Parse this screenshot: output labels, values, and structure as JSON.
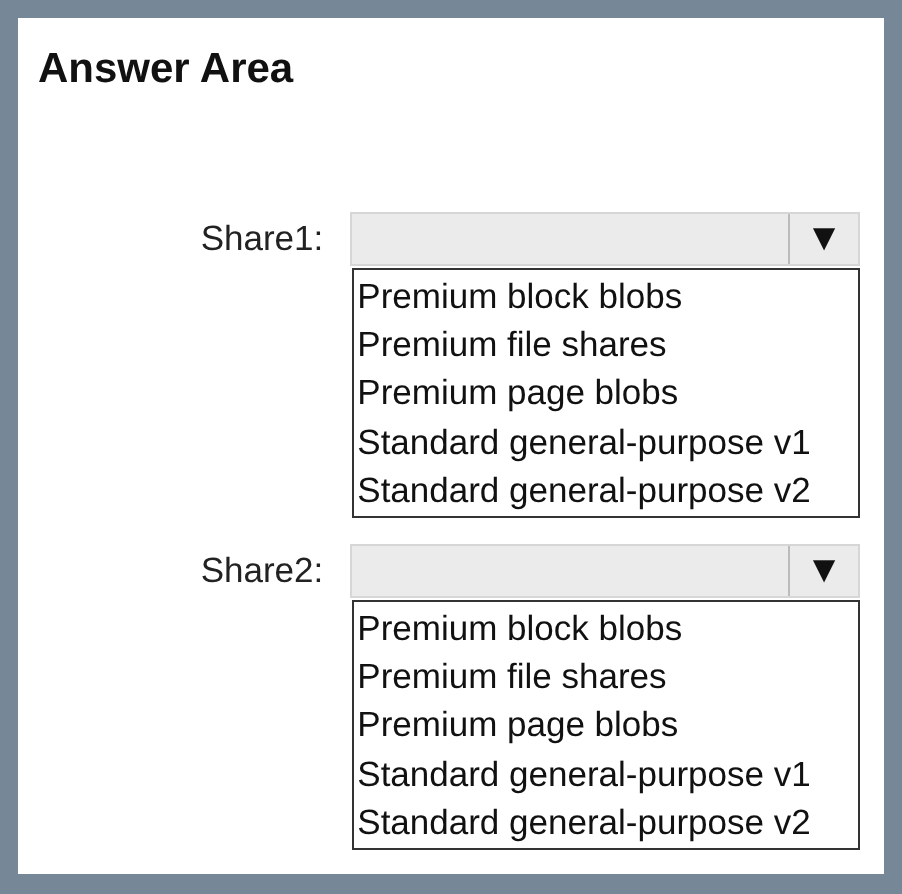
{
  "title": "Answer Area",
  "dropdowns": [
    {
      "label": "Share1:",
      "arrow": "▼",
      "options": [
        "Premium block blobs",
        "Premium file shares",
        "Premium page blobs",
        "Standard general-purpose v1",
        "Standard general-purpose v2"
      ]
    },
    {
      "label": "Share2:",
      "arrow": "▼",
      "options": [
        "Premium block blobs",
        "Premium file shares",
        "Premium page blobs",
        "Standard general-purpose v1",
        "Standard general-purpose v2"
      ]
    }
  ]
}
